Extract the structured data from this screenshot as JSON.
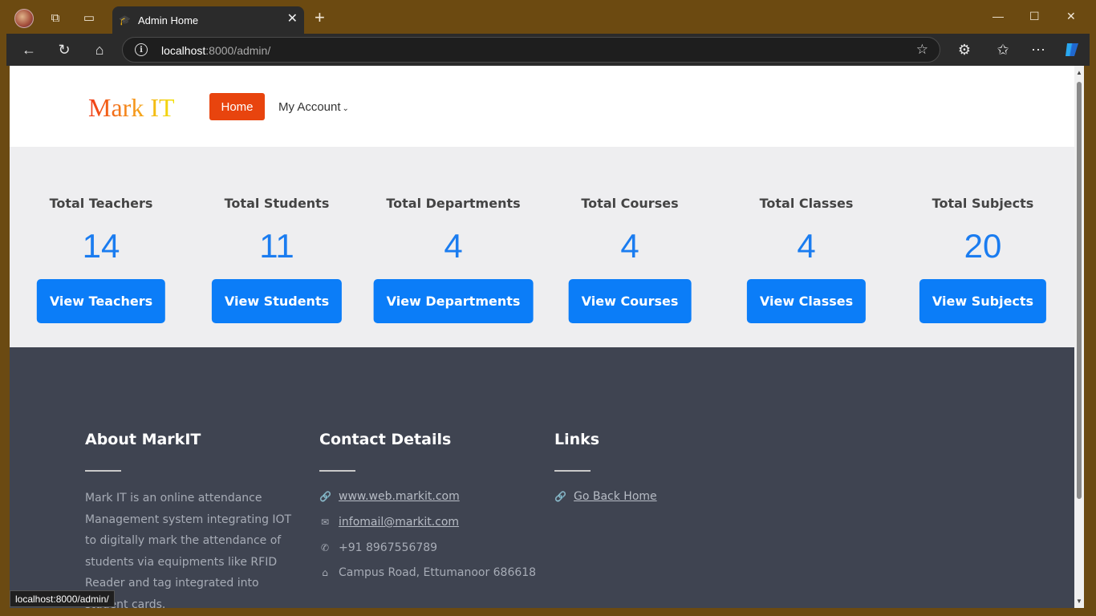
{
  "browser": {
    "tab_title": "Admin Home",
    "url_host": "localhost",
    "url_rest": ":8000/admin/",
    "status_url": "localhost:8000/admin/"
  },
  "header": {
    "logo": "Mark IT",
    "nav": {
      "home": "Home",
      "account": "My Account"
    }
  },
  "stats": [
    {
      "title": "Total Teachers",
      "value": "14",
      "button": "View Teachers"
    },
    {
      "title": "Total Students",
      "value": "11",
      "button": "View Students"
    },
    {
      "title": "Total Departments",
      "value": "4",
      "button": "View Departments"
    },
    {
      "title": "Total Courses",
      "value": "4",
      "button": "View Courses"
    },
    {
      "title": "Total Classes",
      "value": "4",
      "button": "View Classes"
    },
    {
      "title": "Total Subjects",
      "value": "20",
      "button": "View Subjects"
    }
  ],
  "footer": {
    "about": {
      "heading": "About MarkIT",
      "text": "Mark IT is an online attendance Management system integrating IOT to digitally mark the attendance of students via equipments like RFID Reader and tag integrated into student cards."
    },
    "contact": {
      "heading": "Contact Details",
      "website": "www.web.markit.com",
      "email": "infomail@markit.com",
      "phone": "+91 8967556789",
      "address": "Campus Road, Ettumanoor 686618"
    },
    "links": {
      "heading": "Links",
      "home_link": "Go Back Home"
    }
  },
  "colors": {
    "accent_orange": "#e8440e",
    "accent_blue": "#0b7df8",
    "footer_bg": "#3f4451"
  }
}
